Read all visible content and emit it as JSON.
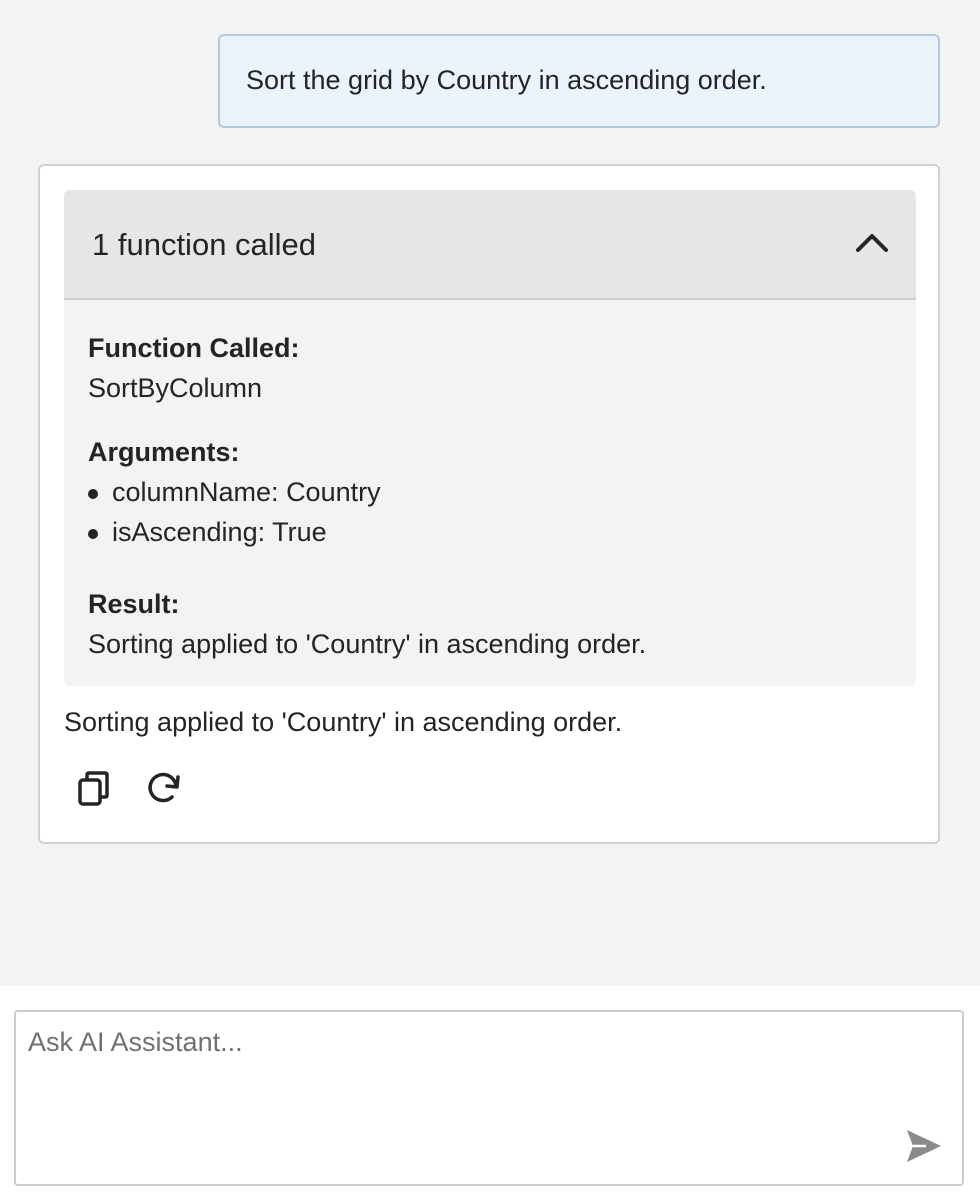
{
  "user_message": "Sort the grid by Country in ascending order.",
  "function_panel": {
    "header": "1 function called",
    "expanded": true,
    "function_called_label": "Function Called:",
    "function_name": "SortByColumn",
    "arguments_label": "Arguments:",
    "arguments": [
      "columnName: Country",
      "isAscending: True"
    ],
    "result_label": "Result:",
    "result": "Sorting applied to 'Country' in ascending order."
  },
  "assistant_response": "Sorting applied to 'Country' in ascending order.",
  "actions": {
    "copy_icon": "copy-icon",
    "refresh_icon": "refresh-icon"
  },
  "prompt": {
    "placeholder": "Ask AI Assistant...",
    "value": "",
    "send_icon": "send-icon"
  },
  "colors": {
    "user_bubble_bg": "#ebf3fc",
    "user_bubble_border": "#b4c8de",
    "panel_header_bg": "#e6e6e6",
    "panel_body_bg": "#f3f3f3",
    "send_icon": "#8a8a8a"
  }
}
